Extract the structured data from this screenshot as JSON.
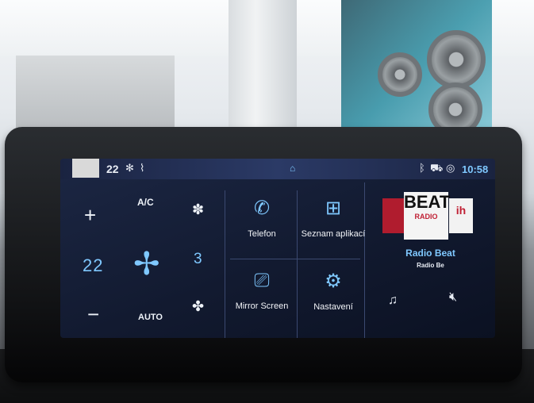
{
  "status_bar": {
    "temperature": "22",
    "clock": "10:58",
    "icons": [
      "fan-icon",
      "seat-heat-icon",
      "home-icon",
      "bluetooth-icon",
      "car-icon",
      "connectivity-icon"
    ]
  },
  "climate": {
    "plus_label": "+",
    "minus_label": "−",
    "ac_label": "A/C",
    "temperature": "22",
    "fan_level": "3",
    "auto_label": "AUTO"
  },
  "tiles": {
    "phone": {
      "label": "Telefon",
      "icon": "phone-icon"
    },
    "apps": {
      "label": "Seznam aplikací",
      "icon": "apps-grid-icon"
    },
    "mirror": {
      "label": "Mirror Screen",
      "icon": "mirror-screen-icon"
    },
    "settings": {
      "label": "Nastavení",
      "icon": "gear-icon"
    }
  },
  "radio": {
    "station": "Radio Beat",
    "station_sub": "Radio Be",
    "logo_text": "BEAT",
    "logo_sub": "RADIO"
  },
  "colors": {
    "accent": "#7fc8ff",
    "screen_bg": "#121a30"
  }
}
